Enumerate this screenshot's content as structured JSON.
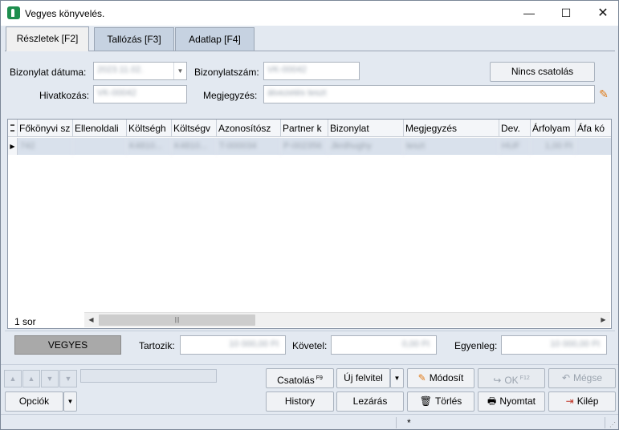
{
  "window": {
    "title": "Vegyes könyvelés.",
    "minimize": "—",
    "maximize": "☐",
    "close": "✕"
  },
  "tabs": [
    {
      "label": "Részletek [F2]"
    },
    {
      "label": "Tallózás [F3]"
    },
    {
      "label": "Adatlap [F4]"
    }
  ],
  "header": {
    "date_label": "Bizonylat dátuma:",
    "date_value": "2023.11.02.",
    "doc_number_label": "Bizonylatszám:",
    "doc_number_value": "VK-00042",
    "no_attachment_button": "Nincs csatolás",
    "reference_label": "Hivatkozás:",
    "reference_value": "VK-00042",
    "note_label": "Megjegyzés:",
    "note_value": "átvezetés teszt"
  },
  "grid": {
    "columns": [
      "Főkönyvi sz",
      "Ellenoldali",
      "Költségh",
      "Költségv",
      "Azonosítósz",
      "Partner k",
      "Bizonylat",
      "Megjegyzés",
      "Dev.",
      "Árfolyam",
      "Áfa kó"
    ],
    "rows": [
      [
        "742",
        "",
        "K4810...",
        "K4810...",
        "T-000034",
        "P-002356",
        "Jkrdhughy",
        "teszt",
        "HUF",
        "1,00 Ft",
        ""
      ]
    ],
    "row_count": "1 sor",
    "scroll_thumb": "|||"
  },
  "totals": {
    "type_label": "VEGYES",
    "debit_label": "Tartozik:",
    "debit_value": "10 000,00 Ft",
    "credit_label": "Követel:",
    "credit_value": "0,00 Ft",
    "balance_label": "Egyenleg:",
    "balance_value": "10 000,00 Ft"
  },
  "buttons": {
    "attach": "Csatolás",
    "attach_key": "F9",
    "new_entry": "Új felvitel",
    "modify": "Módosít",
    "ok": "OK",
    "ok_key": "F12",
    "cancel": "Mégse",
    "options": "Opciók",
    "history": "History",
    "close_entry": "Lezárás",
    "delete": "Törlés",
    "print": "Nyomtat",
    "exit": "Kilép"
  },
  "status": {
    "marker": "*"
  },
  "colors": {
    "brand": "#1e8e4e",
    "selected_row": "#d9e1ec",
    "panel": "#e3e9f1",
    "edit_icon": "#e07b18"
  }
}
